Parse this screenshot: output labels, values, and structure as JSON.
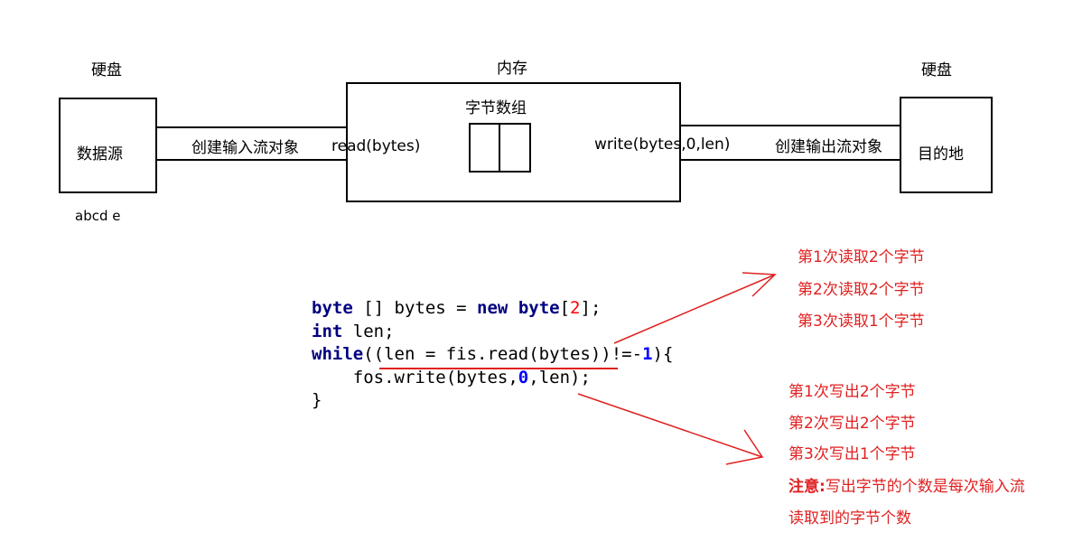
{
  "left_disk": {
    "title": "硬盘",
    "box_label": "数据源",
    "content": "abcd e"
  },
  "memory": {
    "title": "内存",
    "array_label": "字节数组",
    "read_label": "read(bytes)",
    "write_label": "write(bytes,0,len)"
  },
  "right_disk": {
    "title": "硬盘",
    "box_label": "目的地"
  },
  "pipes": {
    "input_label": "创建输入流对象",
    "output_label": "创建输出流对象"
  },
  "code": {
    "line1": {
      "kw1": "byte",
      "text1": " [] bytes = ",
      "kw2": "new",
      "text2": " ",
      "kw3": "byte",
      "text3": "[",
      "num": "2",
      "text4": "];"
    },
    "line2": {
      "kw": "int",
      "text": " len;"
    },
    "line3": {
      "kw": "while",
      "text1": "((len = fis.read(bytes))!=-",
      "num": "1",
      "text2": "){"
    },
    "line4": {
      "indent": "    ",
      "text1": "fos.write(bytes,",
      "num": "0",
      "text2": ",len);"
    },
    "line5": {
      "text": "}"
    }
  },
  "read_notes": [
    "第1次读取2个字节",
    "第2次读取2个字节",
    "第3次读取1个字节"
  ],
  "write_notes": [
    "第1次写出2个字节",
    "第2次写出2个字节",
    "第3次写出1个字节"
  ],
  "attention": {
    "prefix": "注意:",
    "text": "写出字节的个数是每次输入流",
    "text2": "读取到的字节个数"
  },
  "colors": {
    "annotation": "#e02020",
    "keyword": "#000080",
    "number_red": "#ff0000",
    "number_blue": "#0000ff"
  }
}
